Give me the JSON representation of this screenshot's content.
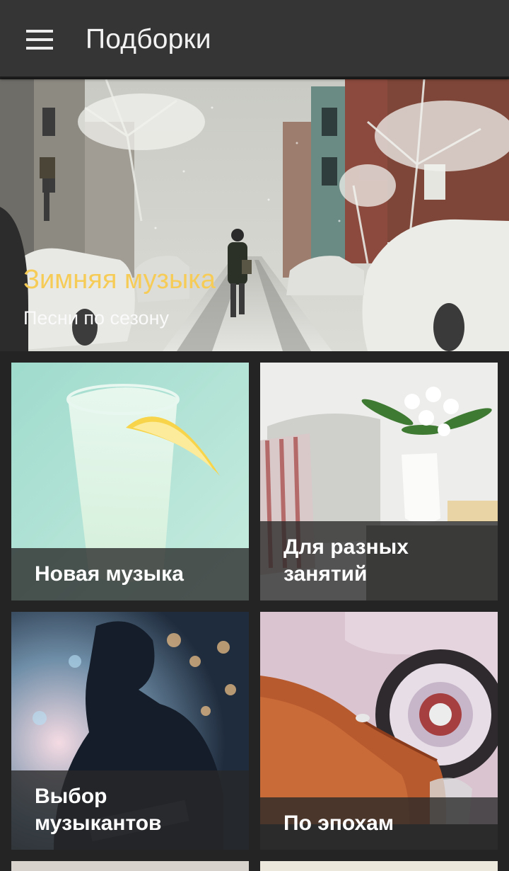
{
  "toolbar": {
    "title": "Подборки",
    "menu_icon": "hamburger-menu-icon"
  },
  "hero": {
    "title": "Зимняя музыка",
    "subtitle": "Песни по сезону",
    "title_color": "#f6cc57"
  },
  "tiles": [
    {
      "label": "Новая музыка"
    },
    {
      "label": "Для разных занятий"
    },
    {
      "label": "Выбор музыкантов"
    },
    {
      "label": "По эпохам"
    }
  ],
  "colors": {
    "toolbar_bg": "#353535",
    "page_bg": "#242424",
    "caption_overlay": "rgba(40,40,40,0.78)"
  }
}
